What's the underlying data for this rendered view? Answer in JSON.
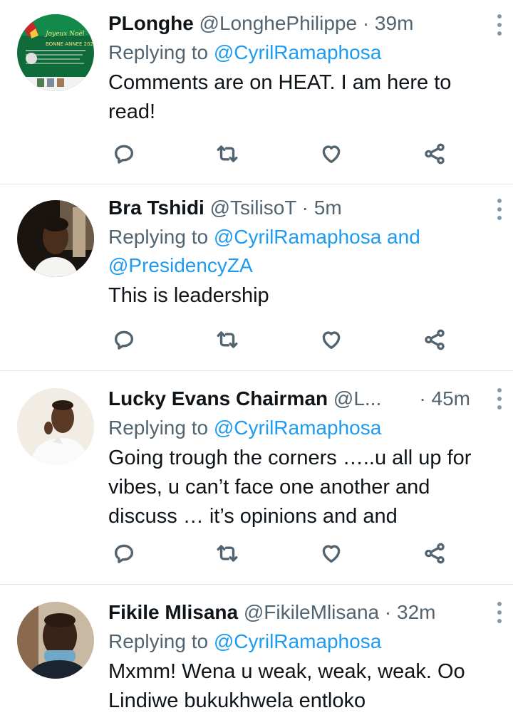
{
  "tweets": [
    {
      "name": "PLonghe",
      "handle": "@LonghePhilippe",
      "time": "39m",
      "reply_prefix": "Replying to",
      "mention1": "@CyrilRamaphosa",
      "mention_joiner": "",
      "mention2": "",
      "lines": [
        "Comments are on HEAT. I am here to",
        "read!"
      ],
      "avatar_text": [
        "Joyeux Noël",
        "BONNE ANNEE 2022"
      ]
    },
    {
      "name": "Bra Tshidi",
      "handle": "@TsilisoT",
      "time": "5m",
      "reply_prefix": "Replying to",
      "mention1": "@CyrilRamaphosa",
      "mention_joiner": "and",
      "mention2": "@PresidencyZA",
      "lines": [
        "This is leadership"
      ]
    },
    {
      "name": "Lucky Evans Chairman",
      "handle": "@L...",
      "time": "45m",
      "reply_prefix": "Replying to",
      "mention1": "@CyrilRamaphosa",
      "mention_joiner": "",
      "mention2": "",
      "lines": [
        "Going trough the corners …..u all up for",
        "vibes, u can’t face one another and",
        "discuss … it’s opinions and and"
      ]
    },
    {
      "name": "Fikile Mlisana",
      "handle": "@FikileMlisana",
      "time": "32m",
      "reply_prefix": "Replying to",
      "mention1": "@CyrilRamaphosa",
      "mention_joiner": "",
      "mention2": "",
      "lines": [
        "Mxmm! Wena u weak, weak, weak. Oo",
        "Lindiwe bukukhwela entloko"
      ]
    }
  ],
  "separator": "·",
  "icons": {
    "reply": "reply-icon",
    "retweet": "retweet-icon",
    "like": "like-icon",
    "share": "share-icon",
    "more": "more-options-icon"
  },
  "colors": {
    "link": "#1d9bf0",
    "secondary_text": "#536471",
    "primary_text": "#0f1419",
    "divider": "#e3e7ea"
  }
}
